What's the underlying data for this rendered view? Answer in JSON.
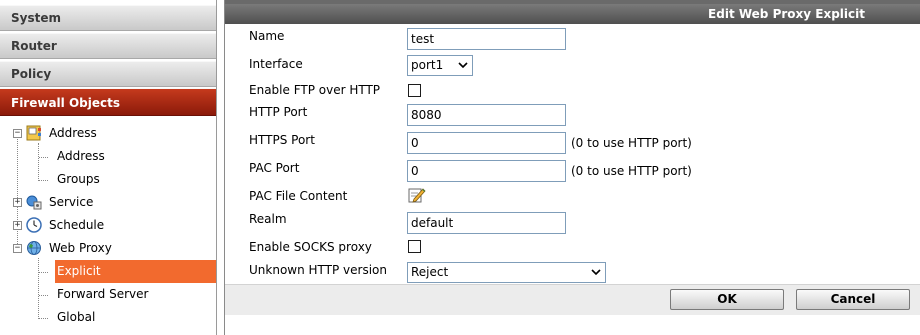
{
  "nav": {
    "sections": [
      {
        "label": "System"
      },
      {
        "label": "Router"
      },
      {
        "label": "Policy"
      },
      {
        "label": "Firewall Objects"
      }
    ],
    "tree": [
      {
        "label": "Address",
        "icon": "address-book-icon",
        "expander": "−"
      },
      {
        "label": "Address"
      },
      {
        "label": "Groups"
      },
      {
        "label": "Service",
        "icon": "service-icon",
        "expander": "+"
      },
      {
        "label": "Schedule",
        "icon": "clock-icon",
        "expander": "+"
      },
      {
        "label": "Web Proxy",
        "icon": "globe-icon",
        "expander": "−"
      },
      {
        "label": "Explicit"
      },
      {
        "label": "Forward Server"
      },
      {
        "label": "Global"
      }
    ]
  },
  "form": {
    "title": "Edit Web Proxy Explicit",
    "fields": [
      {
        "label": "Name",
        "value": "test"
      },
      {
        "label": "Interface",
        "value": "port1"
      },
      {
        "label": "Enable FTP over HTTP"
      },
      {
        "label": "HTTP Port",
        "value": "8080"
      },
      {
        "label": "HTTPS Port",
        "value": "0",
        "hint": "(0 to use HTTP port)"
      },
      {
        "label": "PAC Port",
        "value": "0",
        "hint": "(0 to use HTTP port)"
      },
      {
        "label": "PAC File Content",
        "icon": "edit-pencil-icon"
      },
      {
        "label": "Realm",
        "value": "default"
      },
      {
        "label": "Enable SOCKS proxy"
      },
      {
        "label": "Unknown HTTP version",
        "value": "Reject"
      }
    ],
    "ok_label": "OK",
    "cancel_label": "Cancel"
  },
  "colors": {
    "active_section": "#a82812",
    "selected_item": "#f26a2e",
    "title_bar": "#5f5f5f"
  }
}
